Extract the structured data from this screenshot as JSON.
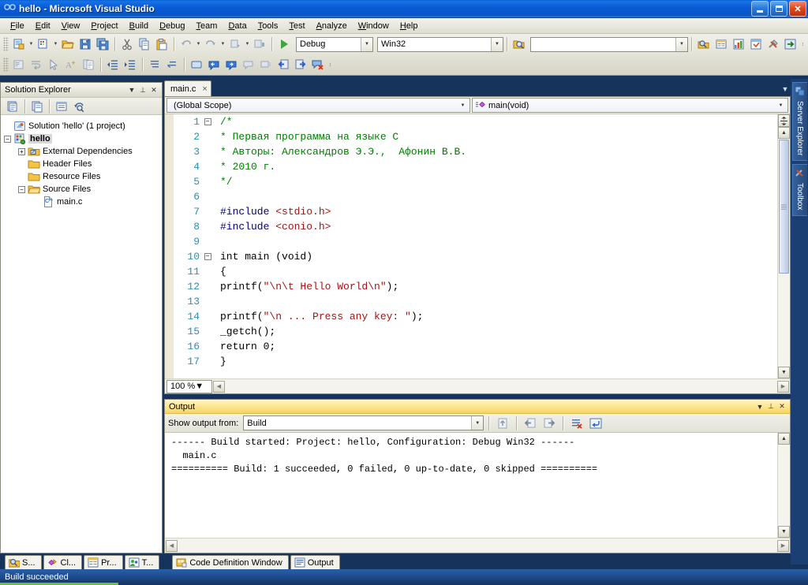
{
  "window": {
    "title": "hello - Microsoft Visual Studio",
    "app_icon": "visual-studio-icon",
    "minimize_label": "Minimize",
    "maximize_label": "Restore",
    "close_label": "Close"
  },
  "menu": {
    "items": [
      "File",
      "Edit",
      "View",
      "Project",
      "Build",
      "Debug",
      "Team",
      "Data",
      "Tools",
      "Test",
      "Analyze",
      "Window",
      "Help"
    ]
  },
  "toolbar": {
    "config_value": "Debug",
    "platform_value": "Win32",
    "find_value": "",
    "find_placeholder": "",
    "buttons": [
      "new-project-icon",
      "add-new-item-icon",
      "open-file-icon",
      "save-icon",
      "save-all-icon",
      "cut-icon",
      "copy-icon",
      "paste-icon",
      "undo-icon",
      "redo-icon",
      "navigate-backward-icon",
      "navigate-forward-icon",
      "start-debug-icon"
    ],
    "right_buttons": [
      "solution-explorer-icon",
      "properties-window-icon",
      "object-browser-icon",
      "toolbox-icon",
      "tools-icon",
      "publish-icon"
    ],
    "text_editor_buttons": [
      "display-windows-icon",
      "toggle-word-wrap-icon",
      "pointer-icon",
      "font-size-icon",
      "comment-icon",
      "decrease-indent-icon",
      "increase-indent-icon",
      "comment-selection-icon",
      "uncomment-selection-icon",
      "toggle-bookmark-icon",
      "previous-bookmark-icon",
      "next-bookmark-icon",
      "previous-bookmark-folder-icon",
      "next-bookmark-folder-icon",
      "go-back-icon",
      "go-forward-icon",
      "clear-bookmarks-icon"
    ]
  },
  "solution_explorer": {
    "title": "Solution Explorer",
    "header_buttons": [
      "chevron-down-icon",
      "pin-icon",
      "close-icon"
    ],
    "toolbar_buttons": [
      "properties-icon",
      "show-all-files-icon",
      "view-code-icon",
      "refresh-icon"
    ],
    "tree": [
      {
        "label": "Solution 'hello' (1 project)",
        "icon": "solution-icon",
        "indent": 0,
        "expander": "",
        "bold": false,
        "selected": false
      },
      {
        "label": "hello",
        "icon": "project-icon",
        "indent": 0,
        "expander": "minus",
        "bold": true,
        "selected": true
      },
      {
        "label": "External Dependencies",
        "icon": "folder-deps-icon",
        "indent": 1,
        "expander": "plus",
        "bold": false,
        "selected": false
      },
      {
        "label": "Header Files",
        "icon": "folder-icon",
        "indent": 1,
        "expander": "",
        "bold": false,
        "selected": false
      },
      {
        "label": "Resource Files",
        "icon": "folder-icon",
        "indent": 1,
        "expander": "",
        "bold": false,
        "selected": false
      },
      {
        "label": "Source Files",
        "icon": "folder-open-icon",
        "indent": 1,
        "expander": "minus",
        "bold": false,
        "selected": false
      },
      {
        "label": "main.c",
        "icon": "c-file-icon",
        "indent": 2,
        "expander": "",
        "bold": false,
        "selected": false
      }
    ]
  },
  "editor": {
    "tab_label": "main.c",
    "tab_close": "×",
    "scope_value": "(Global Scope)",
    "function_value": "main(void)",
    "function_icon": "method-icon",
    "zoom_value": "100 %",
    "lines": [
      {
        "num": "1",
        "fold": "minus",
        "changed": false,
        "tokens": [
          {
            "t": "/*",
            "c": "k-comment"
          }
        ]
      },
      {
        "num": "2",
        "fold": "bar",
        "changed": false,
        "tokens": [
          {
            "t": "* Первая программа на языке С",
            "c": "k-comment"
          }
        ]
      },
      {
        "num": "3",
        "fold": "bar",
        "changed": false,
        "tokens": [
          {
            "t": "* Авторы: Александров Э.Э.,  Афонин В.В.",
            "c": "k-comment"
          }
        ]
      },
      {
        "num": "4",
        "fold": "bar",
        "changed": false,
        "tokens": [
          {
            "t": "* 2010 г.",
            "c": "k-comment"
          }
        ]
      },
      {
        "num": "5",
        "fold": "bar",
        "changed": false,
        "tokens": [
          {
            "t": "*/",
            "c": "k-comment"
          }
        ]
      },
      {
        "num": "6",
        "fold": "",
        "changed": false,
        "tokens": [
          {
            "t": "",
            "c": ""
          }
        ]
      },
      {
        "num": "7",
        "fold": "bar",
        "changed": false,
        "tokens": [
          {
            "t": "#include ",
            "c": "k-pp"
          },
          {
            "t": "<stdio.h>",
            "c": "k-inc"
          }
        ]
      },
      {
        "num": "8",
        "fold": "bar",
        "changed": false,
        "tokens": [
          {
            "t": "#include ",
            "c": "k-pp"
          },
          {
            "t": "<conio.h>",
            "c": "k-inc"
          }
        ]
      },
      {
        "num": "9",
        "fold": "",
        "changed": false,
        "tokens": [
          {
            "t": "",
            "c": ""
          }
        ]
      },
      {
        "num": "10",
        "fold": "minus",
        "changed": false,
        "tokens": [
          {
            "t": "int main (void)",
            "c": "k-num"
          }
        ]
      },
      {
        "num": "11",
        "fold": "bar",
        "changed": false,
        "tokens": [
          {
            "t": "{",
            "c": "k-num"
          }
        ]
      },
      {
        "num": "12",
        "fold": "bar",
        "changed": true,
        "tokens": [
          {
            "t": "printf(",
            "c": "k-num"
          },
          {
            "t": "\"\\n\\t Hello World\\n\"",
            "c": "k-str"
          },
          {
            "t": ");",
            "c": "k-num"
          }
        ]
      },
      {
        "num": "13",
        "fold": "bar",
        "changed": false,
        "tokens": [
          {
            "t": "",
            "c": ""
          }
        ]
      },
      {
        "num": "14",
        "fold": "bar",
        "changed": false,
        "tokens": [
          {
            "t": "printf(",
            "c": "k-num"
          },
          {
            "t": "\"\\n ... Press any key: \"",
            "c": "k-str"
          },
          {
            "t": ");",
            "c": "k-num"
          }
        ]
      },
      {
        "num": "15",
        "fold": "bar",
        "changed": false,
        "tokens": [
          {
            "t": "_getch();",
            "c": "k-num"
          }
        ]
      },
      {
        "num": "16",
        "fold": "bar",
        "changed": false,
        "tokens": [
          {
            "t": "return 0;",
            "c": "k-num"
          }
        ]
      },
      {
        "num": "17",
        "fold": "bar",
        "changed": false,
        "tokens": [
          {
            "t": "}",
            "c": "k-num"
          }
        ]
      }
    ]
  },
  "output": {
    "title": "Output",
    "header_buttons": [
      "chevron-down-icon",
      "pin-icon",
      "close-icon"
    ],
    "filter_label": "Show output from:",
    "filter_value": "Build",
    "toolbar_buttons": [
      "find-message-icon",
      "go-to-previous-icon",
      "go-to-next-icon",
      "clear-all-icon",
      "toggle-word-wrap-icon"
    ],
    "lines": [
      "------ Build started: Project: hello, Configuration: Debug Win32 ------",
      "  main.c",
      "========== Build: 1 succeeded, 0 failed, 0 up-to-date, 0 skipped =========="
    ]
  },
  "right_dock": {
    "tabs": [
      {
        "label": "Server Explorer",
        "icon": "server-explorer-icon"
      },
      {
        "label": "Toolbox",
        "icon": "toolbox-icon"
      }
    ]
  },
  "bottom_tabs": [
    {
      "label": "S...",
      "icon": "solution-explorer-icon",
      "active": true
    },
    {
      "label": "Cl...",
      "icon": "class-view-icon",
      "active": false
    },
    {
      "label": "Pr...",
      "icon": "properties-icon",
      "active": false
    },
    {
      "label": "T...",
      "icon": "team-explorer-icon",
      "active": false
    },
    {
      "label": "Code Definition Window",
      "icon": "code-definition-icon",
      "active": false
    },
    {
      "label": "Output",
      "icon": "output-icon",
      "active": true
    }
  ],
  "status_bar": {
    "text": "Build succeeded"
  },
  "colors": {
    "title_blue": "#0b5ad4",
    "accent_green": "#6fbf3f",
    "comment_green": "#008000",
    "string_red": "#a31515",
    "preproc_blue": "#000080",
    "linenum_teal": "#2b91af",
    "output_header": "#ffe68f"
  }
}
